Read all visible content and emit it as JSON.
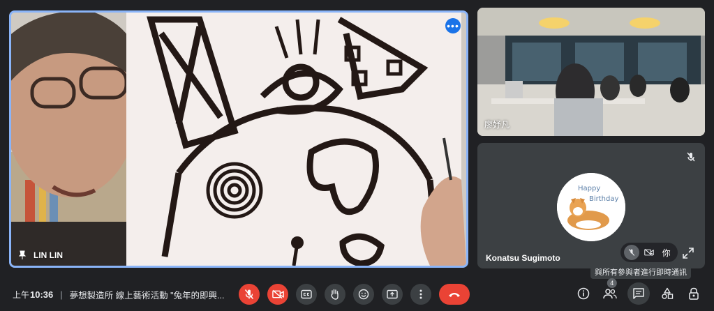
{
  "main_tile": {
    "participant_name": "LIN LIN",
    "more_options_icon": "more-horiz-icon"
  },
  "side_tiles": [
    {
      "participant_name": "廖妤凡"
    },
    {
      "participant_name": "Konatsu Sugimoto",
      "self_label": "你",
      "avatar_text": [
        "Happy",
        "Birthday"
      ]
    }
  ],
  "tooltip": "與所有參與者進行即時通訊",
  "bottom_bar": {
    "time_prefix": "上午",
    "time": "10:36",
    "separator": "|",
    "meeting_title": "夢想製造所 線上藝術活動 \"兔年的即興...",
    "people_count": "4"
  },
  "colors": {
    "background": "#202124",
    "active_border": "#8ab4f8",
    "danger": "#ea4335",
    "button": "#3c4043"
  },
  "icons": {
    "mic_off": "mic-off-icon",
    "camera_off": "videocam-off-icon",
    "captions": "closed-caption-icon",
    "raise_hand": "hand-icon",
    "emoji": "emoji-icon",
    "present": "present-screen-icon",
    "more": "more-vert-icon",
    "end_call": "call-end-icon",
    "info": "info-icon",
    "people": "people-icon",
    "chat": "chat-icon",
    "activities": "activities-icon",
    "host_controls": "lock-person-icon"
  }
}
